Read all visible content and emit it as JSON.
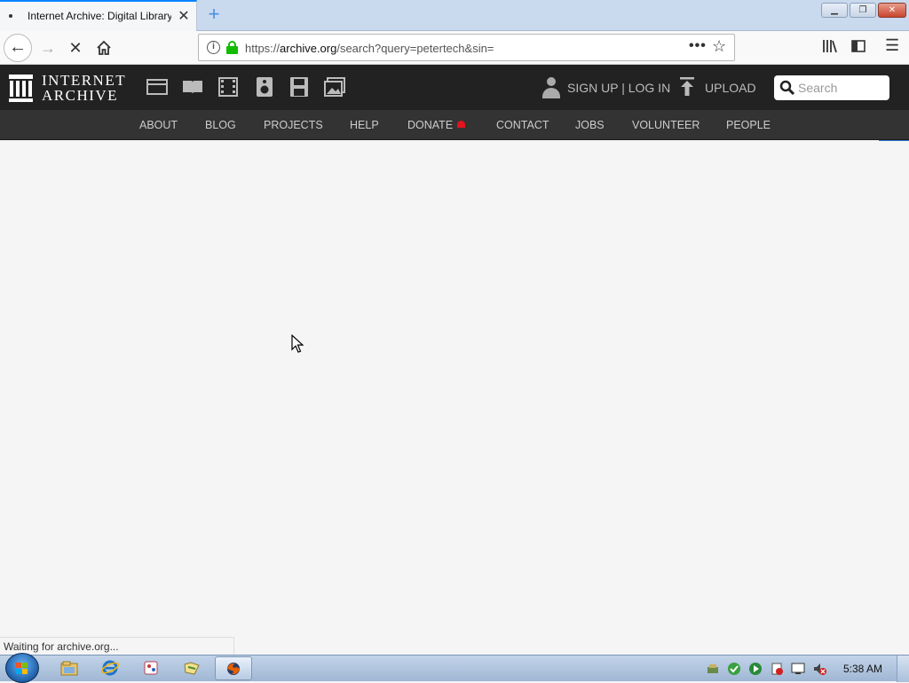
{
  "browser": {
    "tab": {
      "title": "Internet Archive: Digital Library of Free & Borrowable Books, Movies, Music & Wayback Machine",
      "close_glyph": "✕"
    },
    "new_tab_glyph": "+",
    "url": {
      "scheme": "https://",
      "host": "archive.org",
      "path": "/search?query=petertech&sin="
    },
    "page_actions_glyph": "•••",
    "bookmark_glyph": "☆",
    "status_text": "Waiting for archive.org..."
  },
  "site": {
    "logo_line1": "INTERNET",
    "logo_line2": "ARCHIVE",
    "media_icons": [
      "web-icon",
      "texts-icon",
      "video-icon",
      "audio-icon",
      "software-icon",
      "images-icon"
    ],
    "account_text": "SIGN UP | LOG IN",
    "upload_label": "UPLOAD",
    "search_placeholder": "Search",
    "nav": [
      "ABOUT",
      "BLOG",
      "PROJECTS",
      "HELP",
      "DONATE",
      "CONTACT",
      "JOBS",
      "VOLUNTEER",
      "PEOPLE"
    ]
  },
  "taskbar": {
    "clock": "5:38 AM",
    "apps": [
      "explorer",
      "internet-explorer",
      "paint",
      "folder",
      "firefox"
    ]
  },
  "colors": {
    "ia_header": "#222222",
    "ia_subnav": "#333333",
    "donate_heart": "#e0141e",
    "lock_green": "#12bc00"
  }
}
